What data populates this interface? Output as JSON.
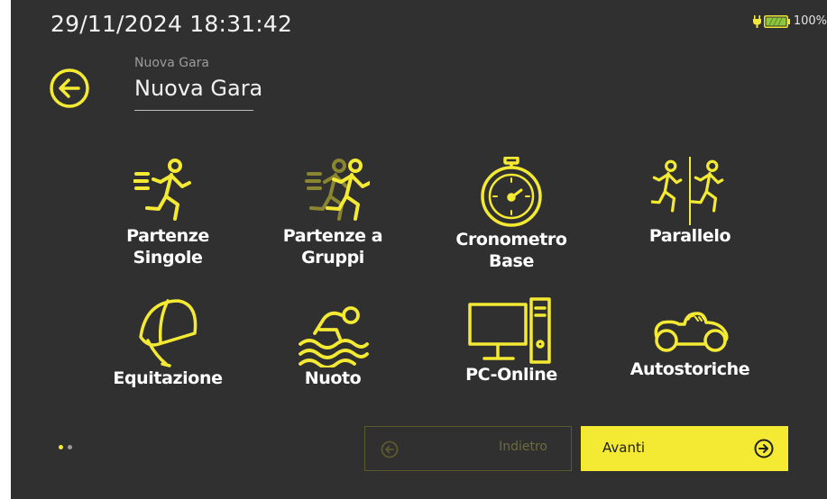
{
  "status_bar": {
    "datetime": "29/11/2024  18:31:42",
    "battery_text": "100%",
    "battery_level": 1.0
  },
  "header": {
    "subtitle": "Nuova Gara",
    "title": "Nuova Gara"
  },
  "tiles": [
    {
      "label": "Partenze\nSingole",
      "icon": "single-runner-icon"
    },
    {
      "label": "Partenze a\nGruppi",
      "icon": "group-runners-icon"
    },
    {
      "label": "Cronometro\nBase",
      "icon": "stopwatch-icon"
    },
    {
      "label": "Parallelo",
      "icon": "parallel-runners-icon"
    },
    {
      "label": "Equitazione",
      "icon": "riding-helmet-icon"
    },
    {
      "label": "Nuoto",
      "icon": "swimmer-icon"
    },
    {
      "label": "PC-Online",
      "icon": "computer-icon"
    },
    {
      "label": "Autostoriche",
      "icon": "vintage-car-icon"
    }
  ],
  "pagination": {
    "pages": 2,
    "current": 1
  },
  "footer": {
    "back_label": "Indietro",
    "next_label": "Avanti"
  },
  "colors": {
    "accent": "#f4ea33",
    "background": "#303030",
    "text": "#ffffff",
    "disabled": "#6c6c3c"
  }
}
